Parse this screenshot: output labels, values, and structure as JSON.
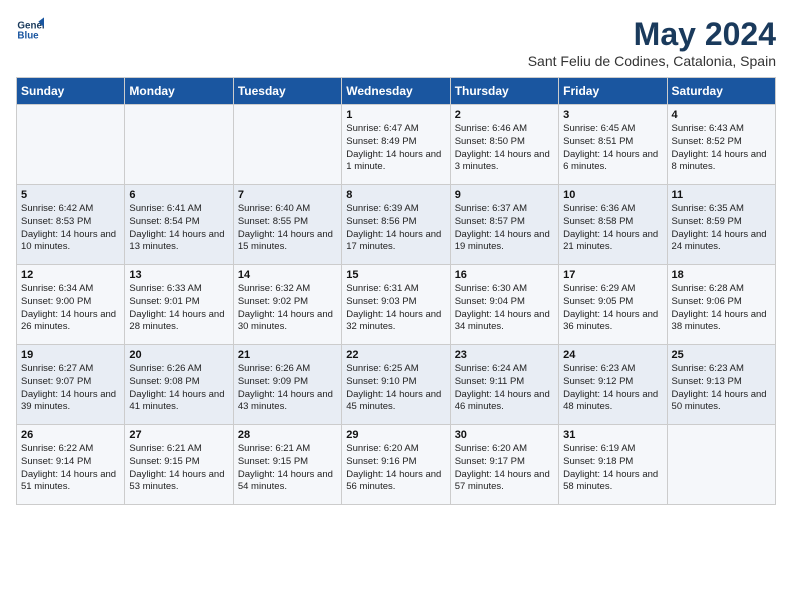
{
  "app": {
    "name_line1": "General",
    "name_line2": "Blue"
  },
  "calendar": {
    "title": "May 2024",
    "subtitle": "Sant Feliu de Codines, Catalonia, Spain"
  },
  "headers": [
    "Sunday",
    "Monday",
    "Tuesday",
    "Wednesday",
    "Thursday",
    "Friday",
    "Saturday"
  ],
  "weeks": [
    [
      {
        "day": "",
        "info": ""
      },
      {
        "day": "",
        "info": ""
      },
      {
        "day": "",
        "info": ""
      },
      {
        "day": "1",
        "info": "Sunrise: 6:47 AM\nSunset: 8:49 PM\nDaylight: 14 hours\nand 1 minute."
      },
      {
        "day": "2",
        "info": "Sunrise: 6:46 AM\nSunset: 8:50 PM\nDaylight: 14 hours\nand 3 minutes."
      },
      {
        "day": "3",
        "info": "Sunrise: 6:45 AM\nSunset: 8:51 PM\nDaylight: 14 hours\nand 6 minutes."
      },
      {
        "day": "4",
        "info": "Sunrise: 6:43 AM\nSunset: 8:52 PM\nDaylight: 14 hours\nand 8 minutes."
      }
    ],
    [
      {
        "day": "5",
        "info": "Sunrise: 6:42 AM\nSunset: 8:53 PM\nDaylight: 14 hours\nand 10 minutes."
      },
      {
        "day": "6",
        "info": "Sunrise: 6:41 AM\nSunset: 8:54 PM\nDaylight: 14 hours\nand 13 minutes."
      },
      {
        "day": "7",
        "info": "Sunrise: 6:40 AM\nSunset: 8:55 PM\nDaylight: 14 hours\nand 15 minutes."
      },
      {
        "day": "8",
        "info": "Sunrise: 6:39 AM\nSunset: 8:56 PM\nDaylight: 14 hours\nand 17 minutes."
      },
      {
        "day": "9",
        "info": "Sunrise: 6:37 AM\nSunset: 8:57 PM\nDaylight: 14 hours\nand 19 minutes."
      },
      {
        "day": "10",
        "info": "Sunrise: 6:36 AM\nSunset: 8:58 PM\nDaylight: 14 hours\nand 21 minutes."
      },
      {
        "day": "11",
        "info": "Sunrise: 6:35 AM\nSunset: 8:59 PM\nDaylight: 14 hours\nand 24 minutes."
      }
    ],
    [
      {
        "day": "12",
        "info": "Sunrise: 6:34 AM\nSunset: 9:00 PM\nDaylight: 14 hours\nand 26 minutes."
      },
      {
        "day": "13",
        "info": "Sunrise: 6:33 AM\nSunset: 9:01 PM\nDaylight: 14 hours\nand 28 minutes."
      },
      {
        "day": "14",
        "info": "Sunrise: 6:32 AM\nSunset: 9:02 PM\nDaylight: 14 hours\nand 30 minutes."
      },
      {
        "day": "15",
        "info": "Sunrise: 6:31 AM\nSunset: 9:03 PM\nDaylight: 14 hours\nand 32 minutes."
      },
      {
        "day": "16",
        "info": "Sunrise: 6:30 AM\nSunset: 9:04 PM\nDaylight: 14 hours\nand 34 minutes."
      },
      {
        "day": "17",
        "info": "Sunrise: 6:29 AM\nSunset: 9:05 PM\nDaylight: 14 hours\nand 36 minutes."
      },
      {
        "day": "18",
        "info": "Sunrise: 6:28 AM\nSunset: 9:06 PM\nDaylight: 14 hours\nand 38 minutes."
      }
    ],
    [
      {
        "day": "19",
        "info": "Sunrise: 6:27 AM\nSunset: 9:07 PM\nDaylight: 14 hours\nand 39 minutes."
      },
      {
        "day": "20",
        "info": "Sunrise: 6:26 AM\nSunset: 9:08 PM\nDaylight: 14 hours\nand 41 minutes."
      },
      {
        "day": "21",
        "info": "Sunrise: 6:26 AM\nSunset: 9:09 PM\nDaylight: 14 hours\nand 43 minutes."
      },
      {
        "day": "22",
        "info": "Sunrise: 6:25 AM\nSunset: 9:10 PM\nDaylight: 14 hours\nand 45 minutes."
      },
      {
        "day": "23",
        "info": "Sunrise: 6:24 AM\nSunset: 9:11 PM\nDaylight: 14 hours\nand 46 minutes."
      },
      {
        "day": "24",
        "info": "Sunrise: 6:23 AM\nSunset: 9:12 PM\nDaylight: 14 hours\nand 48 minutes."
      },
      {
        "day": "25",
        "info": "Sunrise: 6:23 AM\nSunset: 9:13 PM\nDaylight: 14 hours\nand 50 minutes."
      }
    ],
    [
      {
        "day": "26",
        "info": "Sunrise: 6:22 AM\nSunset: 9:14 PM\nDaylight: 14 hours\nand 51 minutes."
      },
      {
        "day": "27",
        "info": "Sunrise: 6:21 AM\nSunset: 9:15 PM\nDaylight: 14 hours\nand 53 minutes."
      },
      {
        "day": "28",
        "info": "Sunrise: 6:21 AM\nSunset: 9:15 PM\nDaylight: 14 hours\nand 54 minutes."
      },
      {
        "day": "29",
        "info": "Sunrise: 6:20 AM\nSunset: 9:16 PM\nDaylight: 14 hours\nand 56 minutes."
      },
      {
        "day": "30",
        "info": "Sunrise: 6:20 AM\nSunset: 9:17 PM\nDaylight: 14 hours\nand 57 minutes."
      },
      {
        "day": "31",
        "info": "Sunrise: 6:19 AM\nSunset: 9:18 PM\nDaylight: 14 hours\nand 58 minutes."
      },
      {
        "day": "",
        "info": ""
      }
    ]
  ]
}
